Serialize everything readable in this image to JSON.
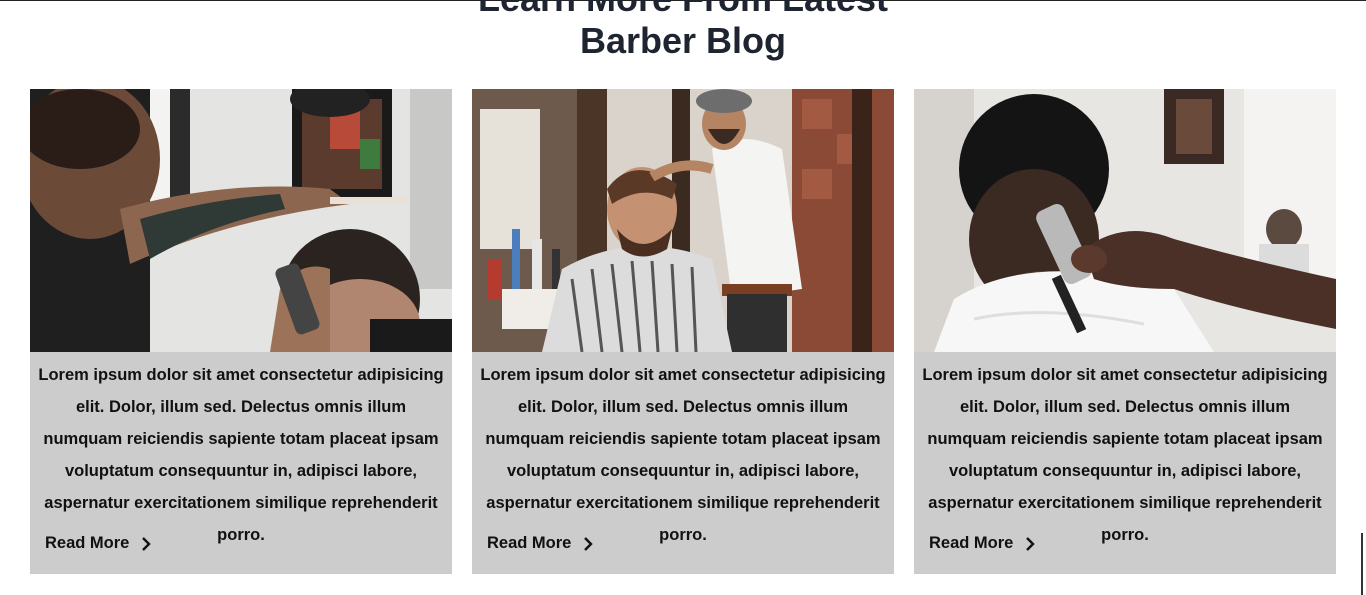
{
  "section": {
    "title_line1": "Learn More From Latest",
    "title_line2": "Barber Blog"
  },
  "cards": [
    {
      "image": "tattooed-barber-trimming-neck-photo",
      "text": "Lorem ipsum dolor sit amet consectetur adipisicing elit. Dolor, illum sed. Delectus omnis illum numquam reiciendis sapiente totam placeat ipsam voluptatum consequuntur in, adipisci labore, aspernatur exercitationem similique reprehenderit porro.",
      "link": "Read More"
    },
    {
      "image": "barber-styling-client-hair-photo",
      "text": "Lorem ipsum dolor sit amet consectetur adipisicing elit. Dolor, illum sed. Delectus omnis illum numquam reiciendis sapiente totam placeat ipsam voluptatum consequuntur in, adipisci labore, aspernatur exercitationem similique reprehenderit porro.",
      "link": "Read More"
    },
    {
      "image": "clipper-neck-fade-photo",
      "text": "Lorem ipsum dolor sit amet consectetur adipisicing elit. Dolor, illum sed. Delectus omnis illum numquam reiciendis sapiente totam placeat ipsam voluptatum consequuntur in, adipisci labore, aspernatur exercitationem similique reprehenderit porro.",
      "link": "Read More"
    }
  ],
  "icons": {
    "read_more": "chevron-right-icon"
  },
  "colors": {
    "card_background": "#cccccc",
    "title": "#1e2430"
  }
}
